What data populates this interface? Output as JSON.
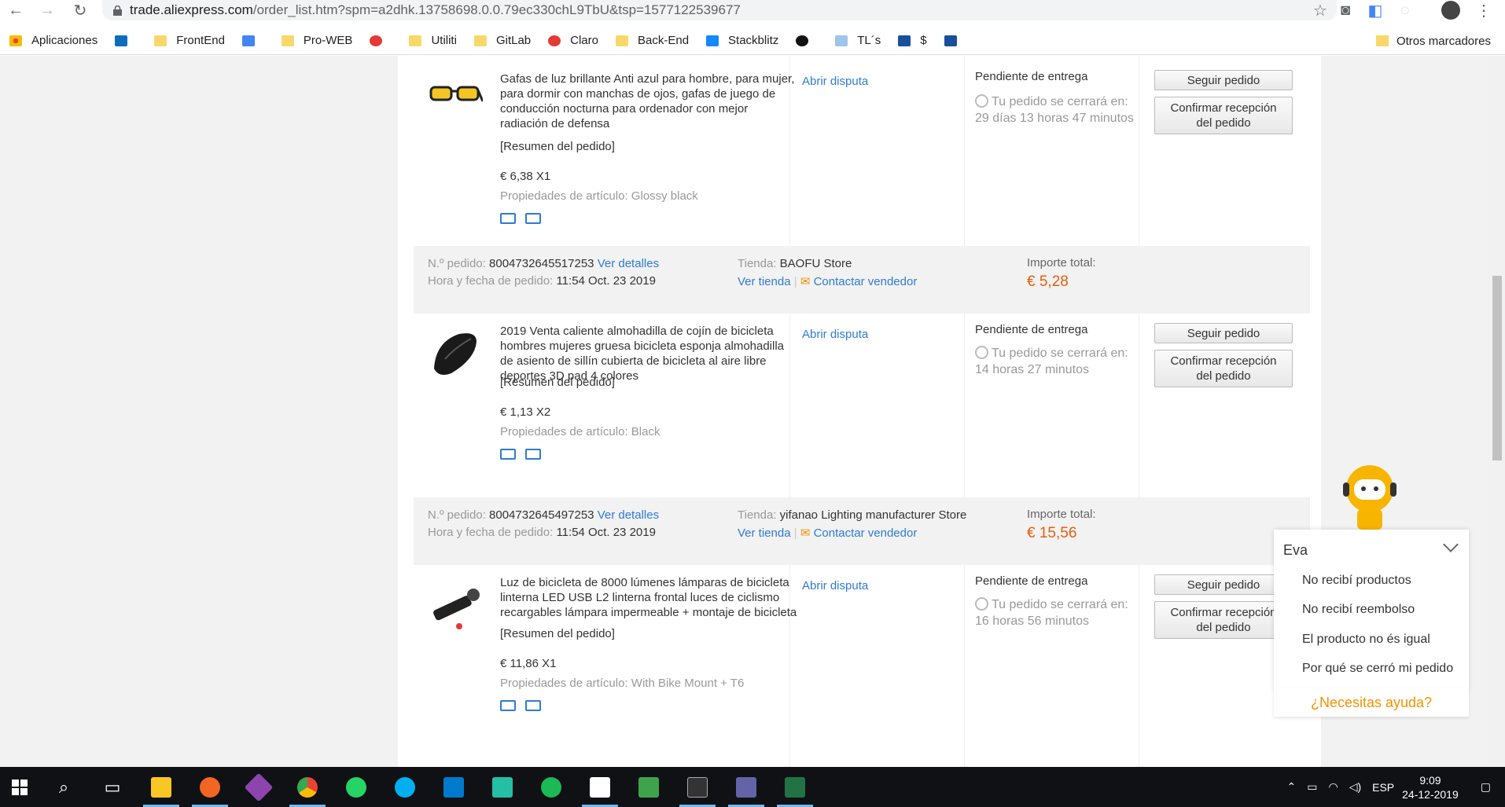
{
  "browser": {
    "url_host": "trade.aliexpress.com",
    "url_rest": "/order_list.htm?spm=a2dhk.13758698.0.0.79ec330chL9TbU&tsp=1577122539677",
    "bookmarks": [
      "Aplicaciones",
      "FrontEnd",
      "Pro-WEB",
      "Utiliti",
      "GitLab",
      "Claro",
      "Back-End",
      "Stackblitz",
      "TL´s",
      "$"
    ],
    "other_bookmarks": "Otros marcadores"
  },
  "labels": {
    "order_no": "N.º pedido:",
    "order_date": "Hora y fecha de pedido:",
    "details": "Ver detalles",
    "store": "Tienda:",
    "view_store": "Ver tienda",
    "contact": "Contactar vendedor",
    "total": "Importe total:",
    "summary": "[Resumen del pedido]",
    "props": "Propiedades de artículo:",
    "dispute": "Abrir disputa",
    "status": "Pendiente de entrega",
    "track": "Seguir pedido",
    "confirm1": "Confirmar recepción",
    "confirm2": "del pedido"
  },
  "orders": [
    {
      "title": "Gafas de luz brillante Anti azul para hombre, para mujer, para dormir con manchas de ojos, gafas de juego de conducción nocturna para ordenador con mejor radiación de defensa",
      "price": "€ 6,38 X1",
      "props": "Glossy black",
      "countdown": "Tu pedido se cerrará en: 29 días 13 horas 47 minutos"
    },
    {
      "number": "8004732645517253",
      "date": "11:54 Oct. 23 2019",
      "store": "BAOFU Store",
      "total": "€ 5,28",
      "title": "2019 Venta caliente almohadilla de cojín de bicicleta hombres mujeres gruesa bicicleta esponja almohadilla de asiento de sillín cubierta de bicicleta al aire libre deportes 3D pad 4 colores",
      "price": "€ 1,13 X2",
      "props": "Black",
      "countdown": "Tu pedido se cerrará en: 14 horas 27 minutos"
    },
    {
      "number": "8004732645497253",
      "date": "11:54 Oct. 23 2019",
      "store": "yifanao Lighting manufacturer Store",
      "total": "€ 15,56",
      "title": "Luz de bicicleta de 8000 lúmenes lámparas de bicicleta linterna LED USB L2 linterna frontal luces de ciclismo recargables lámpara impermeable + montaje de bicicleta",
      "price": "€ 11,86 X1",
      "props": "With Bike Mount + T6",
      "countdown": "Tu pedido se cerrará en: 16 horas 56 minutos"
    }
  ],
  "chat": {
    "title": "Eva",
    "options": [
      "No recibí productos",
      "No recibí reembolso",
      "El producto no és igual",
      "Por qué se cerró mi pedido"
    ],
    "help": "¿Necesitas ayuda?"
  },
  "taskbar": {
    "lang": "ESP",
    "time": "9:09",
    "date": "24-12-2019"
  },
  "colors": {
    "link": "#2e7bd5",
    "price": "#e85c0e",
    "help": "#f39200"
  }
}
